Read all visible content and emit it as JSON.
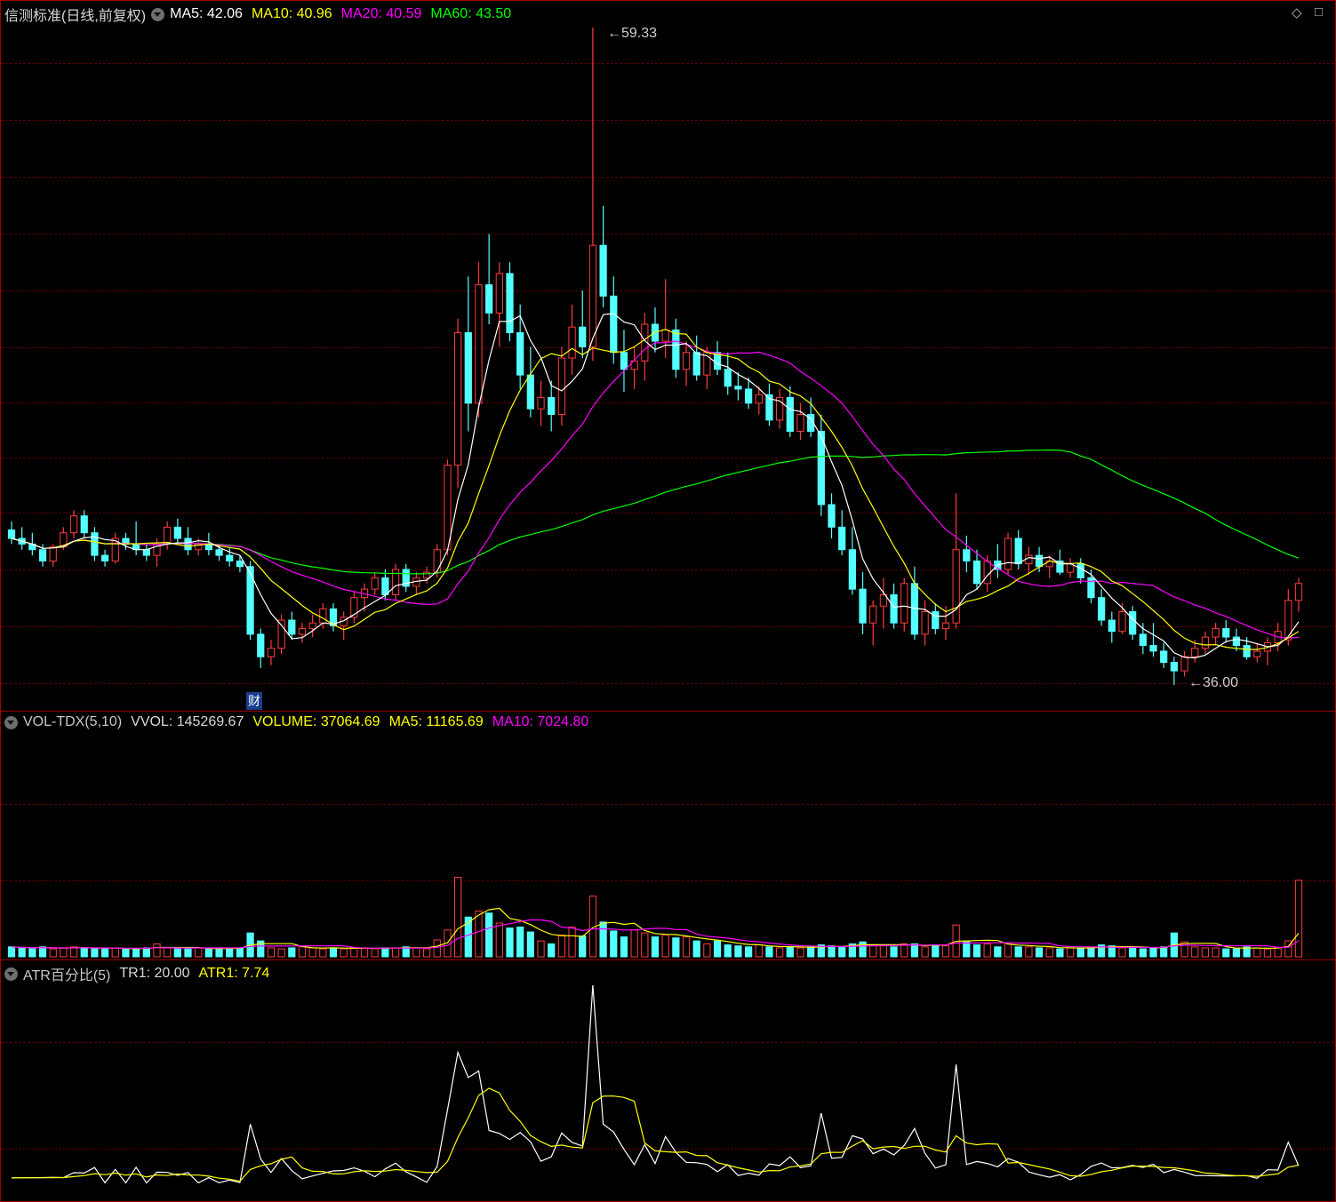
{
  "main": {
    "title": "信测标准(日线,前复权)",
    "ma5": "MA5: 42.06",
    "ma10": "MA10: 40.96",
    "ma20": "MA20: 40.59",
    "ma60": "MA60: 43.50",
    "high_label": "59.33",
    "low_label": "36.00",
    "badge": "财",
    "diamond_icon": "◇",
    "window_icon": "□"
  },
  "vol": {
    "name": "VOL-TDX(5,10)",
    "vvol": "VVOL: 145269.67",
    "volume": "VOLUME: 37064.69",
    "ma5": "MA5: 11165.69",
    "ma10": "MA10: 7024.80"
  },
  "atr": {
    "name": "ATR百分比(5)",
    "tr1": "TR1: 20.00",
    "atr1": "ATR1: 7.74"
  },
  "colors": {
    "up": "#ff3c3c",
    "down": "#54ffff",
    "ma5": "#ffffff",
    "ma10": "#ffff00",
    "ma20": "#ff00ff",
    "ma60": "#00ff00",
    "grid": "#5a0000"
  },
  "chart_data": {
    "type": "candlestick",
    "price_scale": {
      "max": 59.33,
      "min": 36.0
    },
    "candles_ohlc": [
      [
        41.5,
        41.8,
        41.0,
        41.2
      ],
      [
        41.2,
        41.6,
        40.8,
        41.0
      ],
      [
        41.0,
        41.4,
        40.6,
        40.8
      ],
      [
        40.8,
        41.0,
        40.2,
        40.4
      ],
      [
        40.4,
        41.0,
        40.2,
        40.9
      ],
      [
        40.9,
        41.6,
        40.8,
        41.4
      ],
      [
        41.4,
        42.2,
        41.2,
        42.0
      ],
      [
        42.0,
        42.2,
        41.2,
        41.4
      ],
      [
        41.4,
        41.6,
        40.4,
        40.6
      ],
      [
        40.6,
        40.8,
        40.2,
        40.4
      ],
      [
        40.4,
        41.4,
        40.3,
        41.2
      ],
      [
        41.2,
        41.4,
        40.8,
        41.0
      ],
      [
        41.0,
        41.8,
        40.6,
        40.8
      ],
      [
        40.8,
        41.0,
        40.4,
        40.6
      ],
      [
        40.6,
        41.2,
        40.2,
        41.0
      ],
      [
        41.0,
        41.8,
        40.8,
        41.6
      ],
      [
        41.6,
        41.9,
        41.0,
        41.2
      ],
      [
        41.2,
        41.6,
        40.6,
        40.8
      ],
      [
        40.8,
        41.2,
        40.6,
        41.0
      ],
      [
        41.0,
        41.4,
        40.6,
        40.8
      ],
      [
        40.8,
        41.0,
        40.4,
        40.6
      ],
      [
        40.6,
        40.9,
        40.2,
        40.4
      ],
      [
        40.4,
        40.6,
        40.0,
        40.2
      ],
      [
        40.2,
        40.4,
        37.6,
        37.8
      ],
      [
        37.8,
        38.0,
        36.6,
        37.0
      ],
      [
        37.0,
        37.6,
        36.7,
        37.3
      ],
      [
        37.3,
        38.5,
        37.1,
        38.3
      ],
      [
        38.3,
        38.6,
        37.6,
        37.8
      ],
      [
        37.8,
        38.2,
        37.5,
        38.0
      ],
      [
        38.0,
        38.5,
        37.7,
        38.2
      ],
      [
        38.2,
        38.9,
        38.0,
        38.7
      ],
      [
        38.7,
        38.9,
        37.9,
        38.1
      ],
      [
        38.1,
        38.6,
        37.6,
        38.4
      ],
      [
        38.4,
        39.3,
        38.2,
        39.1
      ],
      [
        39.1,
        39.6,
        38.6,
        39.4
      ],
      [
        39.4,
        40.0,
        39.2,
        39.8
      ],
      [
        39.8,
        40.1,
        39.0,
        39.2
      ],
      [
        39.2,
        40.3,
        39.0,
        40.1
      ],
      [
        40.1,
        40.3,
        39.3,
        39.5
      ],
      [
        39.5,
        40.0,
        39.2,
        39.8
      ],
      [
        39.8,
        40.2,
        39.6,
        40.0
      ],
      [
        40.0,
        41.0,
        39.8,
        40.8
      ],
      [
        40.8,
        44.0,
        40.6,
        43.8
      ],
      [
        43.8,
        49.0,
        43.0,
        48.5
      ],
      [
        48.5,
        50.5,
        45.0,
        46.0
      ],
      [
        46.0,
        51.0,
        45.5,
        50.2
      ],
      [
        50.2,
        52.0,
        48.8,
        49.2
      ],
      [
        49.2,
        51.0,
        48.0,
        50.6
      ],
      [
        50.6,
        51.0,
        48.2,
        48.5
      ],
      [
        48.5,
        49.5,
        46.5,
        47.0
      ],
      [
        47.0,
        48.0,
        45.5,
        45.8
      ],
      [
        45.8,
        46.8,
        45.2,
        46.2
      ],
      [
        46.2,
        46.8,
        45.0,
        45.6
      ],
      [
        45.6,
        48.0,
        45.2,
        47.6
      ],
      [
        47.6,
        49.5,
        47.0,
        48.7
      ],
      [
        48.7,
        50.0,
        47.6,
        48.0
      ],
      [
        48.0,
        59.33,
        47.5,
        51.6
      ],
      [
        51.6,
        53.0,
        49.4,
        49.8
      ],
      [
        49.8,
        50.5,
        47.4,
        47.8
      ],
      [
        47.8,
        48.6,
        46.4,
        47.2
      ],
      [
        47.2,
        48.0,
        46.5,
        47.5
      ],
      [
        47.5,
        49.2,
        46.8,
        48.8
      ],
      [
        48.8,
        49.4,
        47.8,
        48.2
      ],
      [
        48.2,
        50.4,
        47.6,
        48.6
      ],
      [
        48.6,
        49.0,
        46.9,
        47.2
      ],
      [
        47.2,
        48.2,
        46.6,
        47.8
      ],
      [
        47.8,
        48.4,
        46.8,
        47.0
      ],
      [
        47.0,
        48.0,
        46.5,
        47.8
      ],
      [
        47.8,
        48.2,
        47.0,
        47.2
      ],
      [
        47.2,
        47.8,
        46.3,
        46.6
      ],
      [
        46.6,
        47.1,
        46.1,
        46.5
      ],
      [
        46.5,
        46.9,
        45.8,
        46.0
      ],
      [
        46.0,
        46.6,
        45.6,
        46.3
      ],
      [
        46.3,
        46.7,
        45.2,
        45.4
      ],
      [
        45.4,
        46.5,
        45.1,
        46.2
      ],
      [
        46.2,
        46.6,
        44.8,
        45.0
      ],
      [
        45.0,
        46.0,
        44.7,
        45.6
      ],
      [
        45.6,
        46.2,
        44.8,
        45.0
      ],
      [
        45.0,
        45.6,
        42.0,
        42.4
      ],
      [
        42.4,
        42.8,
        41.2,
        41.6
      ],
      [
        41.6,
        42.2,
        40.6,
        40.8
      ],
      [
        40.8,
        41.6,
        39.2,
        39.4
      ],
      [
        39.4,
        40.0,
        37.8,
        38.2
      ],
      [
        38.2,
        39.0,
        37.4,
        38.8
      ],
      [
        38.8,
        39.8,
        38.0,
        39.2
      ],
      [
        39.2,
        39.6,
        38.0,
        38.2
      ],
      [
        38.2,
        39.8,
        37.9,
        39.6
      ],
      [
        39.6,
        40.2,
        37.6,
        37.8
      ],
      [
        37.8,
        39.0,
        37.4,
        38.6
      ],
      [
        38.6,
        38.9,
        37.8,
        38.0
      ],
      [
        38.0,
        38.8,
        37.6,
        38.2
      ],
      [
        38.2,
        42.8,
        38.0,
        40.8
      ],
      [
        40.8,
        41.3,
        40.0,
        40.4
      ],
      [
        40.4,
        40.8,
        39.4,
        39.6
      ],
      [
        39.6,
        40.6,
        39.3,
        40.4
      ],
      [
        40.4,
        41.0,
        39.8,
        40.1
      ],
      [
        40.1,
        41.4,
        39.9,
        41.2
      ],
      [
        41.2,
        41.5,
        40.1,
        40.3
      ],
      [
        40.3,
        40.9,
        39.9,
        40.6
      ],
      [
        40.6,
        40.9,
        40.0,
        40.2
      ],
      [
        40.2,
        40.6,
        39.8,
        40.4
      ],
      [
        40.4,
        40.8,
        39.9,
        40.0
      ],
      [
        40.0,
        40.5,
        39.8,
        40.3
      ],
      [
        40.3,
        40.5,
        39.6,
        39.8
      ],
      [
        39.8,
        40.1,
        38.9,
        39.1
      ],
      [
        39.1,
        39.4,
        38.1,
        38.3
      ],
      [
        38.3,
        38.6,
        37.5,
        37.9
      ],
      [
        37.9,
        38.9,
        37.8,
        38.6
      ],
      [
        38.6,
        38.8,
        37.6,
        37.8
      ],
      [
        37.8,
        38.2,
        37.1,
        37.4
      ],
      [
        37.4,
        38.2,
        37.0,
        37.2
      ],
      [
        37.2,
        37.5,
        36.6,
        36.8
      ],
      [
        36.8,
        37.0,
        36.0,
        36.5
      ],
      [
        36.5,
        37.2,
        36.3,
        37.0
      ],
      [
        37.0,
        37.6,
        36.8,
        37.3
      ],
      [
        37.3,
        37.9,
        37.1,
        37.7
      ],
      [
        37.7,
        38.2,
        37.4,
        38.0
      ],
      [
        38.0,
        38.3,
        37.5,
        37.7
      ],
      [
        37.7,
        38.0,
        37.2,
        37.4
      ],
      [
        37.4,
        37.7,
        36.9,
        37.0
      ],
      [
        37.0,
        37.5,
        36.8,
        37.2
      ],
      [
        37.2,
        37.7,
        36.7,
        37.5
      ],
      [
        37.5,
        38.2,
        37.2,
        37.9
      ],
      [
        37.6,
        39.4,
        37.4,
        39.0
      ],
      [
        39.0,
        39.8,
        38.6,
        39.6
      ]
    ],
    "volume": [
      1,
      0.9,
      0.8,
      1,
      0.8,
      0.9,
      1,
      0.9,
      0.8,
      0.8,
      0.9,
      0.8,
      0.8,
      0.9,
      1.3,
      0.9,
      0.8,
      0.8,
      0.9,
      0.8,
      0.9,
      0.8,
      0.9,
      2.4,
      1.6,
      0.9,
      0.8,
      0.9,
      1.0,
      0.9,
      0.8,
      0.9,
      0.8,
      0.9,
      0.9,
      0.8,
      0.9,
      0.9,
      1.0,
      0.9,
      0.8,
      1.7,
      2.7,
      8.0,
      4.0,
      4.6,
      4.4,
      3.4,
      2.9,
      3.0,
      2.5,
      1.6,
      1.3,
      2.2,
      3.0,
      2.1,
      6.1,
      3.5,
      2.6,
      2.0,
      2.7,
      2.4,
      2.0,
      2.2,
      1.9,
      2.0,
      1.6,
      1.3,
      1.6,
      1.2,
      1.1,
      1.0,
      1.2,
      1.0,
      0.9,
      1.0,
      0.9,
      1.0,
      1.2,
      1.1,
      1.0,
      1.3,
      1.5,
      1.2,
      1.1,
      1.0,
      1.3,
      1.3,
      1.0,
      1.2,
      1.1,
      3.2,
      1.5,
      1.2,
      1.3,
      1.0,
      1.4,
      1.0,
      1.0,
      0.9,
      0.9,
      0.8,
      0.9,
      0.9,
      1.0,
      1.2,
      1.1,
      0.9,
      0.9,
      0.8,
      0.9,
      1.0,
      2.4,
      1.5,
      1.0,
      0.9,
      0.9,
      0.8,
      0.8,
      1.0,
      0.9,
      0.8,
      0.9,
      1.6,
      7.7
    ],
    "volume_scale_max": 22,
    "atr_scale": {
      "max": 20.0,
      "min": 0.0
    }
  }
}
